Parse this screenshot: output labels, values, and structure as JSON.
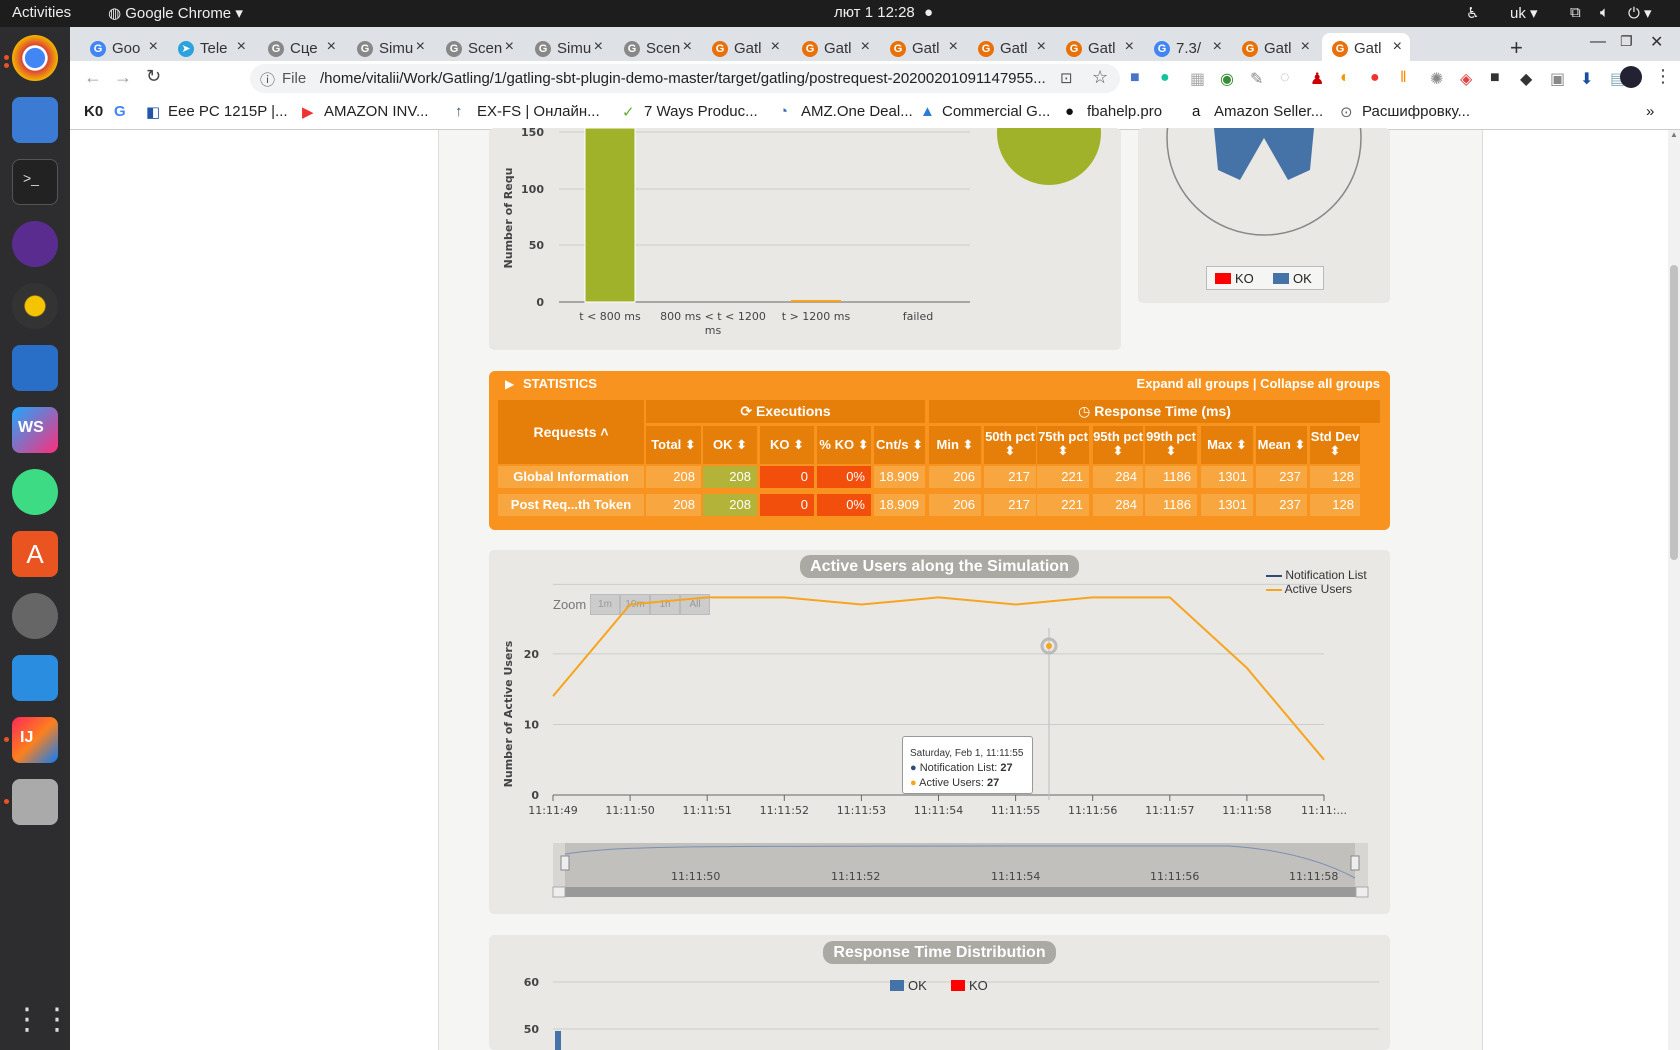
{
  "system": {
    "activities": "Activities",
    "app": "Google Chrome",
    "clock": "лют 1  12:28",
    "lang": "uk"
  },
  "tabs": [
    {
      "label": "Goo",
      "color": "#4285f4",
      "glyph": "G"
    },
    {
      "label": "Tele",
      "color": "#2aa3df",
      "glyph": "➤"
    },
    {
      "label": "Сце",
      "color": "#888",
      "glyph": "G"
    },
    {
      "label": "Simu",
      "color": "#888",
      "glyph": "G"
    },
    {
      "label": "Scen",
      "color": "#888",
      "glyph": "G"
    },
    {
      "label": "Simu",
      "color": "#888",
      "glyph": "G"
    },
    {
      "label": "Scen",
      "color": "#888",
      "glyph": "G"
    },
    {
      "label": "Gatl",
      "color": "#e8710a",
      "glyph": "G"
    },
    {
      "label": "Gatl",
      "color": "#e8710a",
      "glyph": "G"
    },
    {
      "label": "Gatl",
      "color": "#e8710a",
      "glyph": "G"
    },
    {
      "label": "Gatl",
      "color": "#e8710a",
      "glyph": "G"
    },
    {
      "label": "Gatl",
      "color": "#e8710a",
      "glyph": "G"
    },
    {
      "label": "7.3/",
      "color": "#4285f4",
      "glyph": "G"
    },
    {
      "label": "Gatl",
      "color": "#e8710a",
      "glyph": "G"
    },
    {
      "label": "Gatl",
      "color": "#e8710a",
      "glyph": "G"
    }
  ],
  "address": {
    "scheme": "File",
    "url": "/home/vitalii/Work/Gatling/1/gatling-sbt-plugin-demo-master/target/gatling/postrequest-20200201091147955..."
  },
  "bookmarks": [
    "Eee PC 1215P |...",
    "AMAZON INV...",
    "EX-FS | Онлайн...",
    "7 Ways Produc...",
    "AMZ.One Deal...",
    "Commercial G...",
    "fbahelp.pro",
    "Amazon Seller...",
    "Расшифровку..."
  ],
  "top_chart": {
    "y_ticks": [
      "150",
      "100",
      "50",
      "0"
    ],
    "y_label": "Number of Requ",
    "categories": [
      "t < 800 ms",
      "800 ms < t < 1200",
      "ms",
      "t > 1200 ms",
      "failed"
    ],
    "legend": [
      "KO",
      "OK"
    ]
  },
  "stats": {
    "title": "STATISTICS",
    "links": "Expand all groups | Collapse all groups",
    "group_exec": "Executions",
    "group_resp": "Response Time (ms)",
    "requests_header": "Requests ˄",
    "columns": [
      "Total ⬍",
      "OK ⬍",
      "KO ⬍",
      "% KO ⬍",
      "Cnt/s ⬍",
      "Min ⬍",
      "50th pct ⬍",
      "75th pct ⬍",
      "95th pct ⬍",
      "99th pct ⬍",
      "Max ⬍",
      "Mean ⬍",
      "Std Dev ⬍"
    ],
    "rows": [
      {
        "name": "Global Information",
        "values": [
          "208",
          "208",
          "0",
          "0%",
          "18.909",
          "206",
          "217",
          "221",
          "284",
          "1186",
          "1301",
          "237",
          "128"
        ]
      },
      {
        "name": "Post Req...th Token",
        "values": [
          "208",
          "208",
          "0",
          "0%",
          "18.909",
          "206",
          "217",
          "221",
          "284",
          "1186",
          "1301",
          "237",
          "128"
        ]
      }
    ]
  },
  "users_chart": {
    "title": "Active Users along the Simulation",
    "zoom": "Zoom",
    "zoom_buttons": [
      "1m",
      "10m",
      "1h",
      "All"
    ],
    "ylabel": "Number of Active Users",
    "legend": [
      "Notification List",
      "Active Users"
    ],
    "tooltip": {
      "date": "Saturday, Feb 1, 11:11:55",
      "line1_label": "Notification List: ",
      "line1_val": "27",
      "line2_label": "Active Users: ",
      "line2_val": "27"
    },
    "navigator_labels": [
      "11:11:50",
      "11:11:52",
      "11:11:54",
      "11:11:56",
      "11:11:58"
    ]
  },
  "dist_chart": {
    "title": "Response Time Distribution",
    "legend": [
      "OK",
      "KO"
    ],
    "y_ticks": [
      "60",
      "50"
    ]
  },
  "chart_data": {
    "type": "line",
    "title": "Active Users along the Simulation",
    "ylabel": "Number of Active Users",
    "x": [
      "11:11:49",
      "11:11:50",
      "11:11:51",
      "11:11:52",
      "11:11:53",
      "11:11:54",
      "11:11:55",
      "11:11:56",
      "11:11:57",
      "11:11:58",
      "11:11:..."
    ],
    "series": [
      {
        "name": "Active Users",
        "values": [
          14,
          27,
          28,
          28,
          27,
          28,
          27,
          28,
          28,
          18,
          5
        ]
      }
    ],
    "y_ticks": [
      0,
      10,
      20
    ],
    "ylim": [
      0,
      30
    ],
    "colors": {
      "Active Users": "#f7a51f",
      "Notification List": "#2f4b7c"
    }
  }
}
